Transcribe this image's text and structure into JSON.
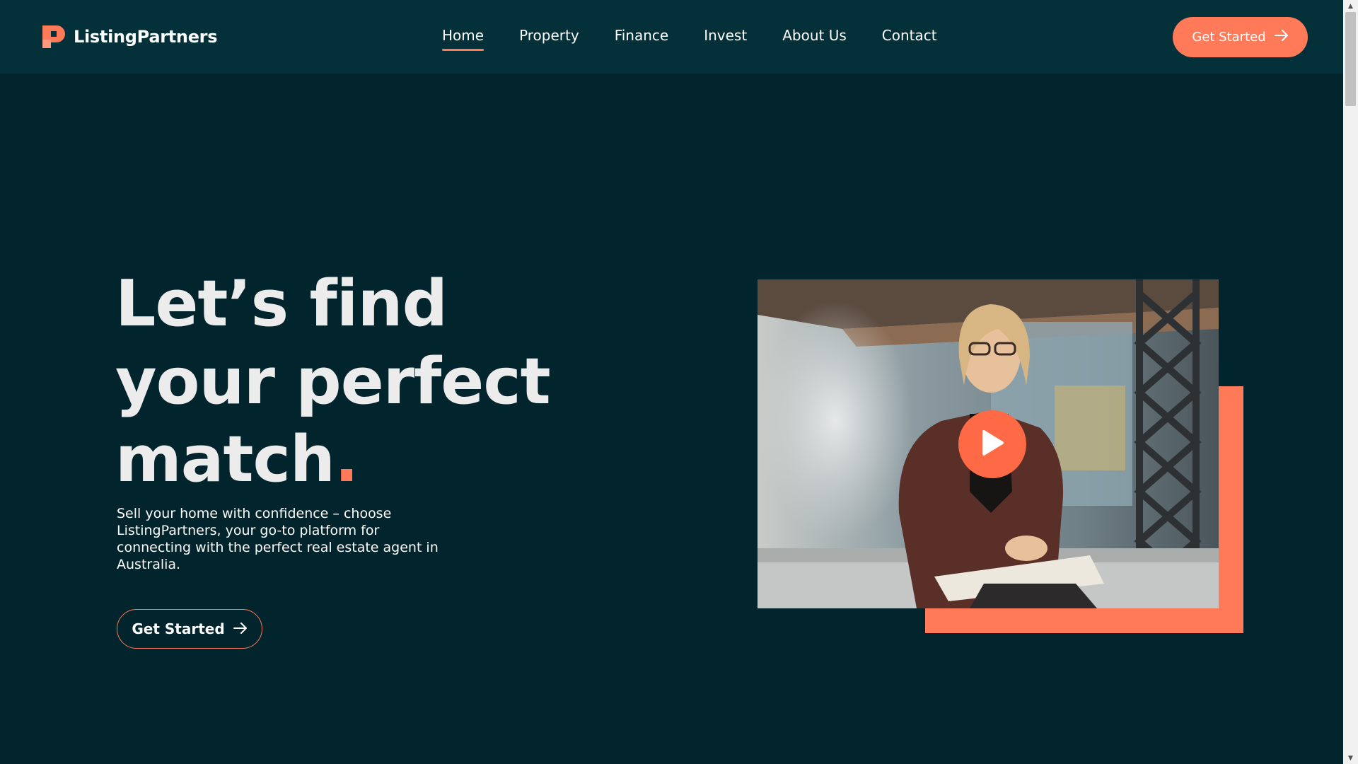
{
  "brand": {
    "name": "ListingPartners",
    "accent_color": "#ff7a59",
    "background_color": "#02242c",
    "header_color": "#033039"
  },
  "nav": {
    "items": [
      {
        "label": "Home",
        "active": true
      },
      {
        "label": "Property",
        "active": false
      },
      {
        "label": "Finance",
        "active": false
      },
      {
        "label": "Invest",
        "active": false
      },
      {
        "label": "About Us",
        "active": false
      },
      {
        "label": "Contact",
        "active": false
      }
    ],
    "cta_label": "Get Started",
    "cta_icon": "arrow-right-icon"
  },
  "hero": {
    "title_line1": "Let’s find",
    "title_line2": "your perfect",
    "title_line3": "match",
    "title_dot": ".",
    "description": "Sell your home with confidence – choose ListingPartners, your go-to platform for connecting with the perfect real estate agent in Australia.",
    "cta_label": "Get Started",
    "cta_icon": "arrow-right-icon"
  },
  "media": {
    "type": "video",
    "play_icon": "play-icon"
  }
}
